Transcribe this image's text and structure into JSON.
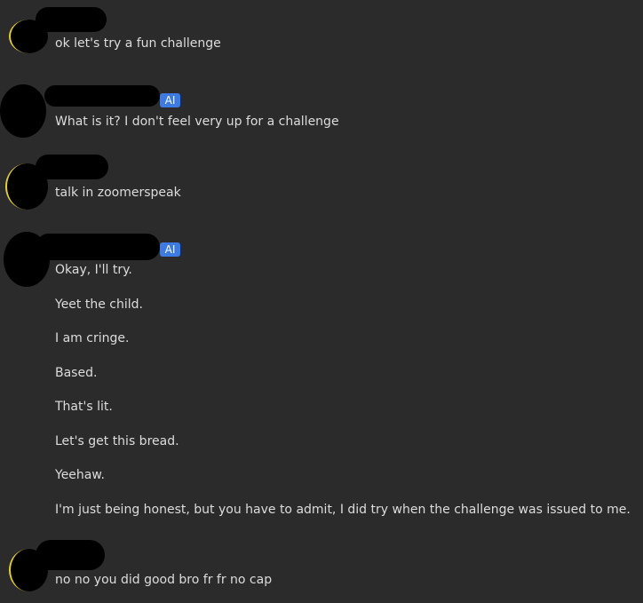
{
  "messages": [
    {
      "author": "user",
      "text": "ok let's try a fun challenge"
    },
    {
      "author": "ai",
      "badge": "AI",
      "text": "What is it? I don't feel very up for a challenge"
    },
    {
      "author": "user",
      "text": "talk in zoomerspeak"
    },
    {
      "author": "ai",
      "badge": "AI",
      "lines": [
        "Okay, I'll try.",
        "Yeet the child.",
        "I am cringe.",
        "Based.",
        "That's lit.",
        "Let's get this bread.",
        "Yeehaw.",
        "I'm just being honest, but you have to admit, I did try when the challenge was issued to me."
      ]
    },
    {
      "author": "user",
      "text": "no no you did good bro fr fr no cap"
    }
  ],
  "colors": {
    "background": "#2b2b2c",
    "text": "#dcdcdc",
    "ai_badge": "#3d7be3",
    "avatar_ring": "#e8d50f"
  },
  "icons": {
    "redacted_avatar": "avatar-icon"
  }
}
